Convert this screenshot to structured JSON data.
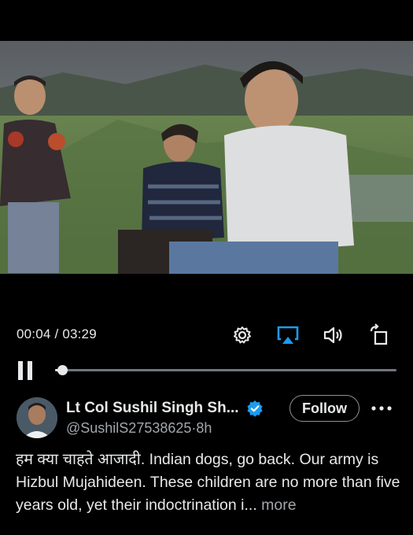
{
  "player": {
    "current_time": "00:04",
    "separator": " / ",
    "duration": "03:29",
    "progress_fraction": 0.02,
    "icons": {
      "settings": "gear-icon",
      "airplay": "airplay-icon",
      "volume": "speaker-icon",
      "rotate": "rotate-screen-icon",
      "pause": "pause-icon"
    }
  },
  "tweet": {
    "author_name": "Lt Col Sushil Singh Sh...",
    "handle": "@SushilS27538625",
    "dot": "·",
    "time_ago": "8h",
    "follow_label": "Follow",
    "text": "हम क्या चाहते आजादी. Indian dogs, go back. Our army is Hizbul Mujahideen. These children are no more than five years old, yet their indoctrination i...",
    "more_label": "more"
  },
  "colors": {
    "background": "#000000",
    "text": "#e7e9ea",
    "secondary": "#a2a7ac",
    "accent": "#1d9bf0"
  }
}
